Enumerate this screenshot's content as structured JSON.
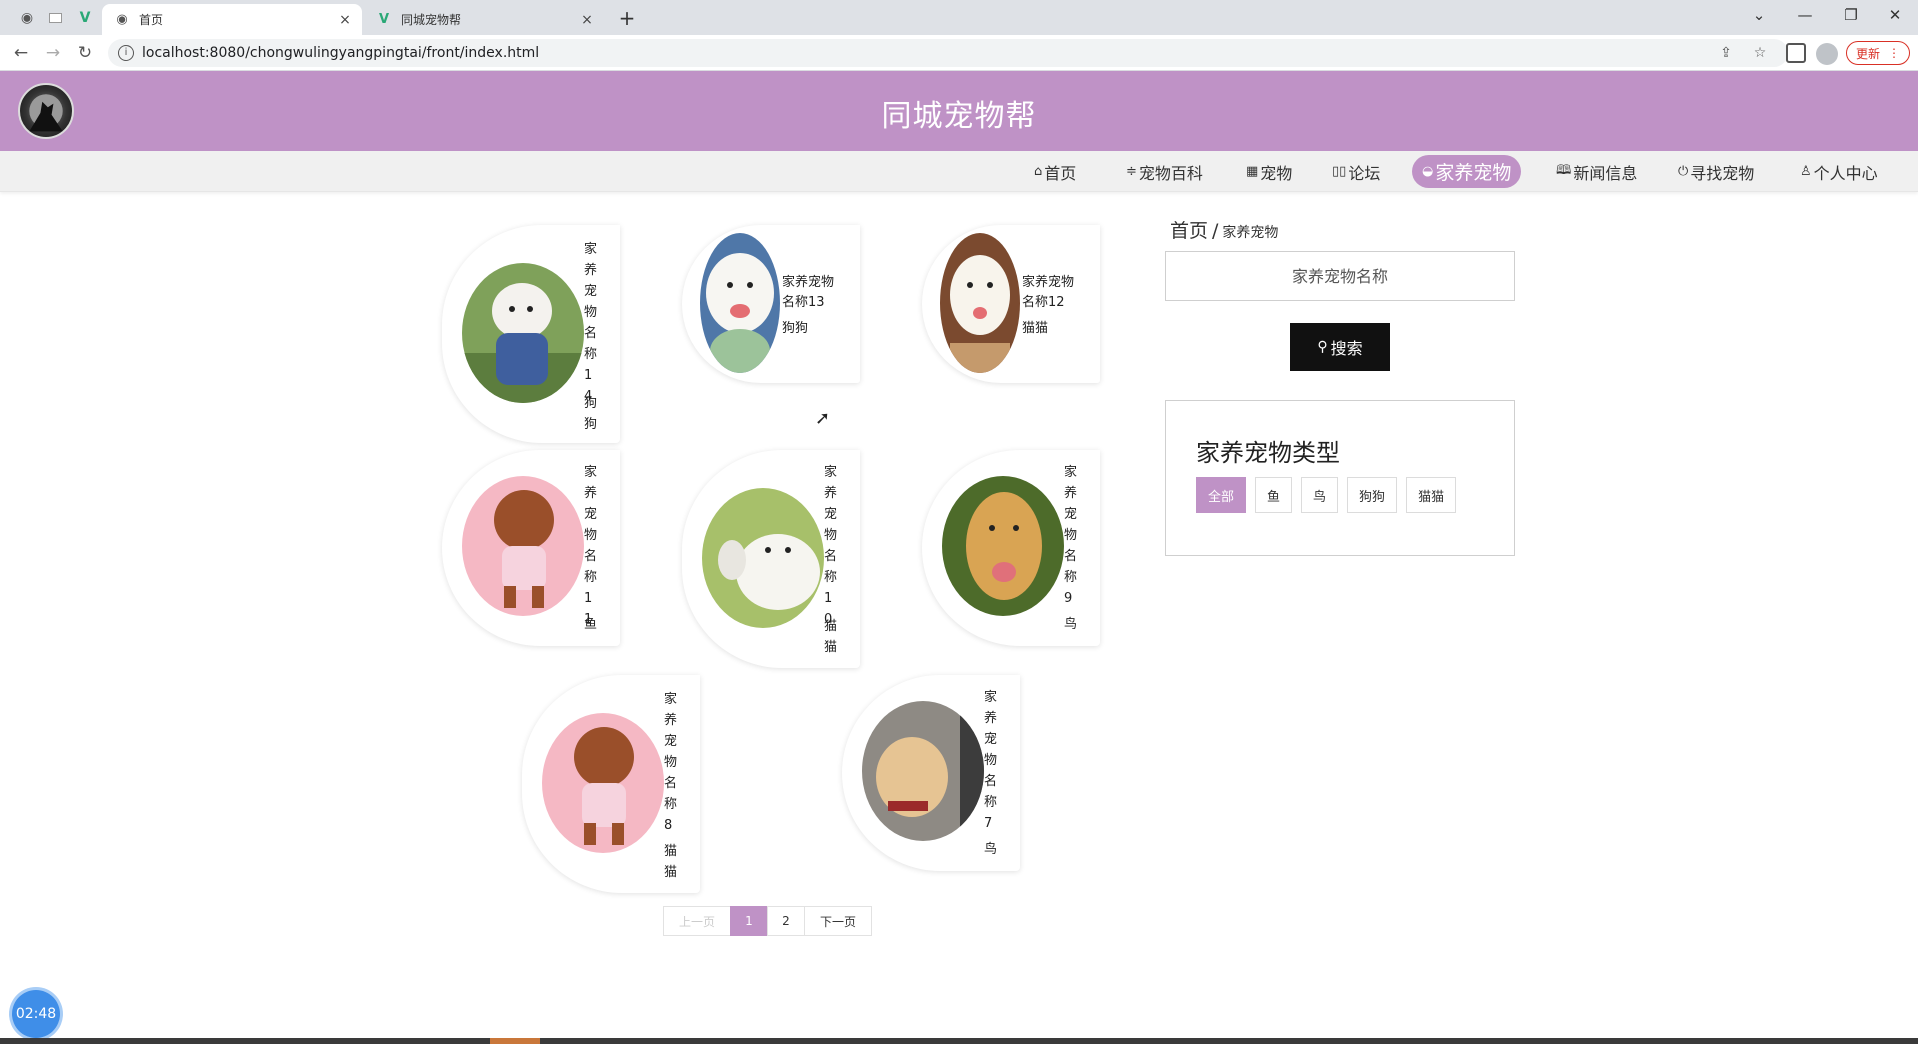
{
  "browser": {
    "tabs": [
      {
        "title": "首页",
        "active": true
      },
      {
        "title": "同城宠物帮",
        "active": false
      }
    ],
    "url": "localhost:8080/chongwulingyangpingtai/front/index.html",
    "update_label": "更新",
    "new_tab": "+",
    "close": "×"
  },
  "site": {
    "title": "同城宠物帮",
    "nav": [
      {
        "icon": "home-icon",
        "glyph": "⌂",
        "label": "首页"
      },
      {
        "icon": "sliders-icon",
        "glyph": "≑",
        "label": "宠物百科"
      },
      {
        "icon": "grid-icon",
        "glyph": "▦",
        "label": "宠物"
      },
      {
        "icon": "forum-icon",
        "glyph": "▯▯",
        "label": "论坛"
      },
      {
        "icon": "stack-icon",
        "glyph": "◒",
        "label": "家养宠物"
      },
      {
        "icon": "book-icon",
        "glyph": "🕮",
        "label": "新闻信息"
      },
      {
        "icon": "power-icon",
        "glyph": "⏻",
        "label": "寻找宠物"
      },
      {
        "icon": "user-icon",
        "glyph": "♙",
        "label": "个人中心"
      }
    ]
  },
  "pets": [
    {
      "name": "家养宠物名称14",
      "type": "狗狗",
      "photo": "white-poodle-blue-shirt"
    },
    {
      "name": "家养宠物名称13",
      "type": "狗狗",
      "photo": "samoyed-bandana"
    },
    {
      "name": "家养宠物名称12",
      "type": "猫猫",
      "photo": "samoyed-puppy"
    },
    {
      "name": "家养宠物名称11",
      "type": "鱼",
      "photo": "brown-poodle-pink"
    },
    {
      "name": "家养宠物名称10",
      "type": "猫猫",
      "photo": "samoyeds-on-grass"
    },
    {
      "name": "家养宠物名称9",
      "type": "鸟",
      "photo": "golden-retriever"
    },
    {
      "name": "家养宠物名称8",
      "type": "猫猫",
      "photo": "brown-poodle-pink"
    },
    {
      "name": "家养宠物名称7",
      "type": "鸟",
      "photo": "golden-puppy-kiss"
    }
  ],
  "pagination": {
    "prev": "上一页",
    "pages": [
      "1",
      "2"
    ],
    "current": "1",
    "next": "下一页"
  },
  "sidebar": {
    "breadcrumb_home": "首页",
    "breadcrumb_sep": "/",
    "breadcrumb_current": "家养宠物",
    "search_placeholder": "家养宠物名称",
    "search_label": "搜索",
    "type_title": "家养宠物类型",
    "types": [
      "全部",
      "鱼",
      "鸟",
      "狗狗",
      "猫猫"
    ],
    "active_type": "全部"
  },
  "clock": "02:48",
  "colors": {
    "accent": "#bf92c6",
    "header": "#bf92c6",
    "search_button": "#111111"
  }
}
